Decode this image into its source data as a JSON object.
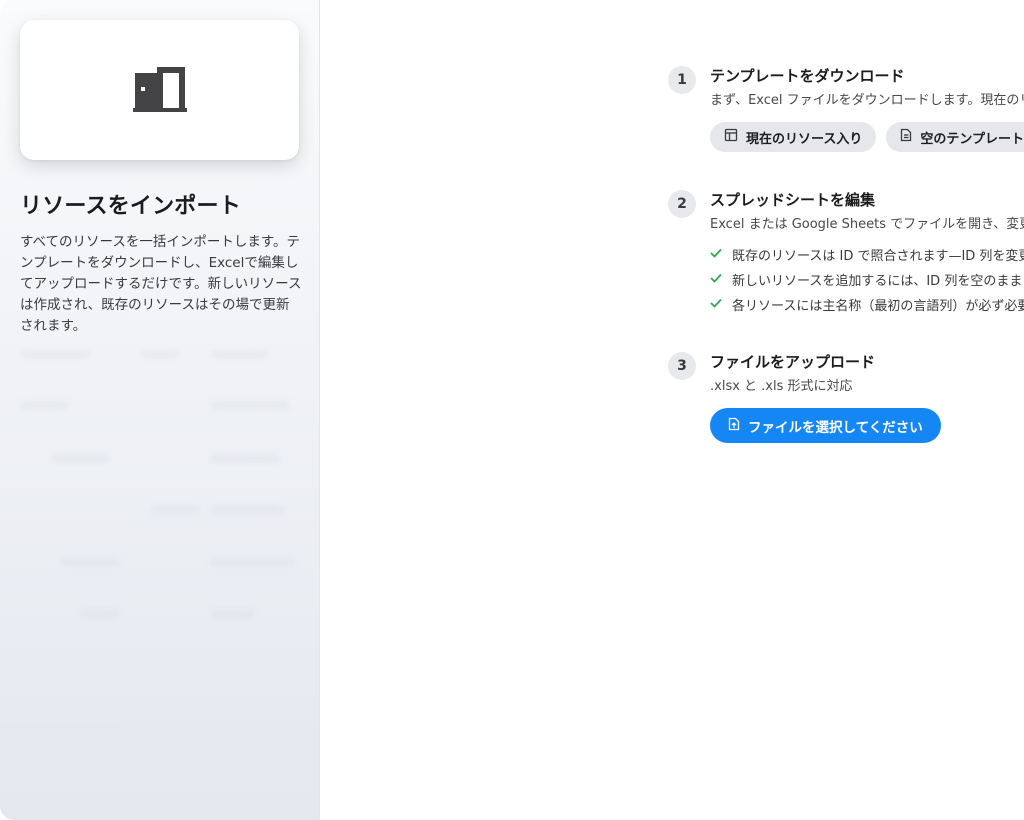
{
  "colors": {
    "accent": "#1487f5",
    "check": "#2fa84f",
    "icon": "#3a3a3c"
  },
  "close": {
    "icon": "close-icon"
  },
  "left": {
    "card_icon": "door-import-icon",
    "title": "リソースをインポート",
    "description": "すべてのリソースを一括インポートします。テンプレートをダウンロードし、Excelで編集してアップロードするだけです。新しいリソースは作成され、既存のリソースはその場で更新されます。"
  },
  "steps": [
    {
      "number": "1",
      "title": "テンプレートをダウンロード",
      "description": "まず、Excel ファイルをダウンロードします。現在のリソース入りか空のテンプレートを選べます。",
      "buttons": [
        {
          "label": "現在のリソース入り",
          "icon": "table-icon"
        },
        {
          "label": "空のテンプレート",
          "icon": "document-icon"
        }
      ]
    },
    {
      "number": "2",
      "title": "スプレッドシートを編集",
      "description": "Excel または Google Sheets でファイルを開き、変更して保存します。",
      "checks": [
        "既存のリソースは ID で照合されます—ID 列を変更しないでください",
        "新しいリソースを追加するには、ID 列を空のままにしてください",
        "各リソースには主名称（最初の言語列）が必ず必要です"
      ]
    },
    {
      "number": "3",
      "title": "ファイルをアップロード",
      "description": ".xlsx と .xls 形式に対応",
      "upload_button": {
        "label": "ファイルを選択してください",
        "icon": "file-upload-icon"
      }
    }
  ]
}
